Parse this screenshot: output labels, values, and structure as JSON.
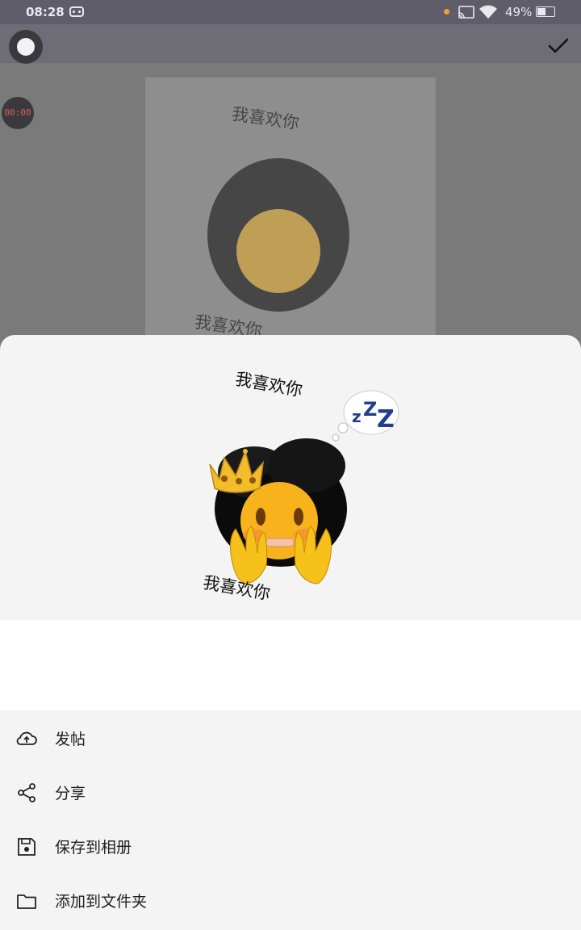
{
  "status_bar": {
    "time": "08:28",
    "battery": "49%"
  },
  "timer": "00:00",
  "sticker": {
    "top_text": "我喜欢你",
    "bottom_text": "我喜欢你"
  },
  "menu": {
    "items": [
      {
        "label": "发帖",
        "icon": "cloud-upload-icon"
      },
      {
        "label": "分享",
        "icon": "share-icon"
      },
      {
        "label": "保存到相册",
        "icon": "save-icon"
      },
      {
        "label": "添加到文件夹",
        "icon": "folder-icon"
      }
    ]
  }
}
